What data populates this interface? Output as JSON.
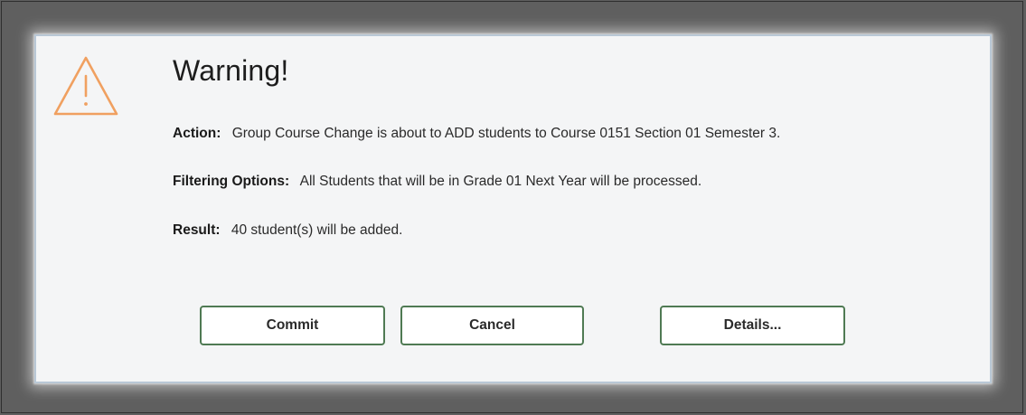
{
  "dialog": {
    "icon": "warning-triangle-icon",
    "icon_color": "#f0a060",
    "title": "Warning!",
    "action": {
      "label": "Action:",
      "text": "Group Course Change is about to ADD students to Course 0151 Section 01 Semester 3."
    },
    "filtering": {
      "label": "Filtering Options:",
      "text": "All Students that will be in Grade 01 Next Year will be processed."
    },
    "result": {
      "label": "Result:",
      "text": "40 student(s) will be added."
    },
    "buttons": {
      "commit": "Commit",
      "cancel": "Cancel",
      "details": "Details..."
    },
    "button_border_color": "#4f7a53"
  }
}
